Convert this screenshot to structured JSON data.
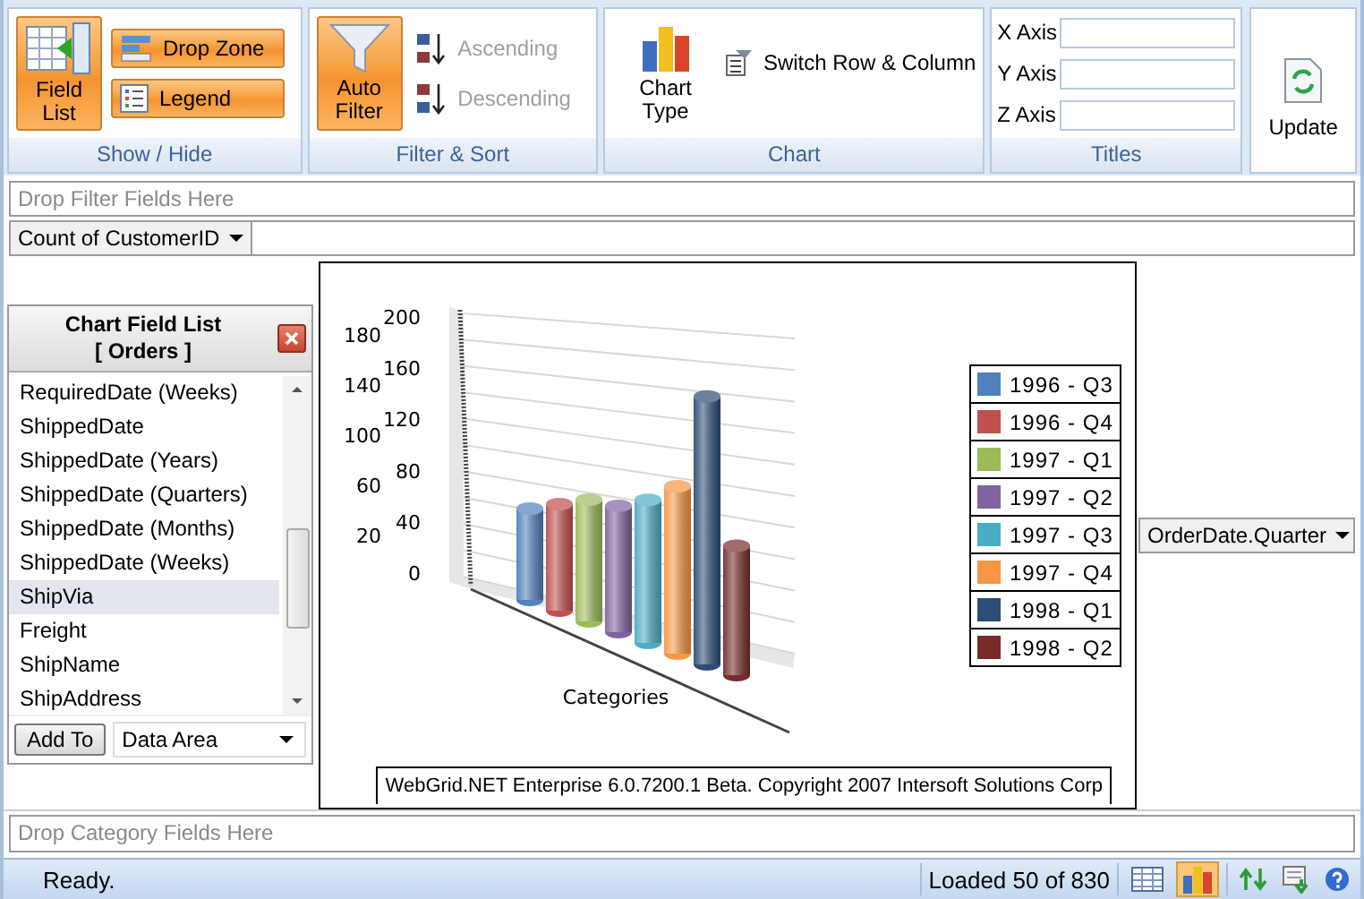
{
  "ribbon": {
    "show_hide": {
      "label": "Show / Hide",
      "field_list": {
        "label": "Field List",
        "selected": true
      },
      "toggles": [
        {
          "label": "Drop Zone",
          "kind": "dropzone",
          "selected": true
        },
        {
          "label": "Legend",
          "kind": "legend",
          "selected": true
        }
      ]
    },
    "filter_sort": {
      "label": "Filter & Sort",
      "auto_filter": {
        "label": "Auto Filter",
        "selected": true
      },
      "sorts": [
        {
          "label": "Ascending",
          "kind": "asc",
          "disabled": true
        },
        {
          "label": "Descending",
          "kind": "desc",
          "disabled": true
        }
      ]
    },
    "chart": {
      "label": "Chart",
      "chart_type": "Chart Type",
      "switch": "Switch Row & Column"
    },
    "titles": {
      "label": "Titles",
      "fields": [
        {
          "label": "X Axis"
        },
        {
          "label": "Y Axis"
        },
        {
          "label": "Z Axis"
        }
      ]
    },
    "update": "Update"
  },
  "filter_zone": "Drop Filter Fields Here",
  "data_field": "Count of CustomerID",
  "field_list": {
    "title": "Chart Field List",
    "subtitle": "[ Orders ]",
    "items": [
      {
        "label": "RequiredDate (Weeks)",
        "selected": false
      },
      {
        "label": "ShippedDate",
        "selected": false
      },
      {
        "label": "ShippedDate (Years)",
        "selected": false
      },
      {
        "label": "ShippedDate (Quarters)",
        "selected": false
      },
      {
        "label": "ShippedDate (Months)",
        "selected": false
      },
      {
        "label": "ShippedDate (Weeks)",
        "selected": false
      },
      {
        "label": "ShipVia",
        "selected": true
      },
      {
        "label": "Freight",
        "selected": false
      },
      {
        "label": "ShipName",
        "selected": false
      },
      {
        "label": "ShipAddress",
        "selected": false
      }
    ],
    "add_button": "Add To",
    "area": "Data Area"
  },
  "chart": {
    "axis_labels": [
      "0",
      "20",
      "40",
      "60",
      "80",
      "100",
      "120",
      "140",
      "160",
      "180",
      "200"
    ],
    "axis_title": "Categories",
    "legend": [
      {
        "label": "1996 - Q3",
        "color": "#4f81bd"
      },
      {
        "label": "1996 - Q4",
        "color": "#c0504d"
      },
      {
        "label": "1997 - Q1",
        "color": "#9bbb59"
      },
      {
        "label": "1997 - Q2",
        "color": "#8064a2"
      },
      {
        "label": "1997 - Q3",
        "color": "#4bacc6"
      },
      {
        "label": "1997 - Q4",
        "color": "#f79646"
      },
      {
        "label": "1998 - Q1",
        "color": "#2c4d75"
      },
      {
        "label": "1998 - Q2",
        "color": "#772c2a"
      }
    ],
    "footer": "WebGrid.NET Enterprise 6.0.7200.1 Beta. Copyright 2007 Intersoft Solutions Corp"
  },
  "series_field": "OrderDate.Quarter",
  "category_zone": "Drop Category Fields Here",
  "status_bar": {
    "text": "Ready.",
    "count": "Loaded 50 of 830",
    "views": [
      {
        "kind": "grid",
        "selected": false
      },
      {
        "kind": "chart",
        "selected": true
      }
    ]
  }
}
